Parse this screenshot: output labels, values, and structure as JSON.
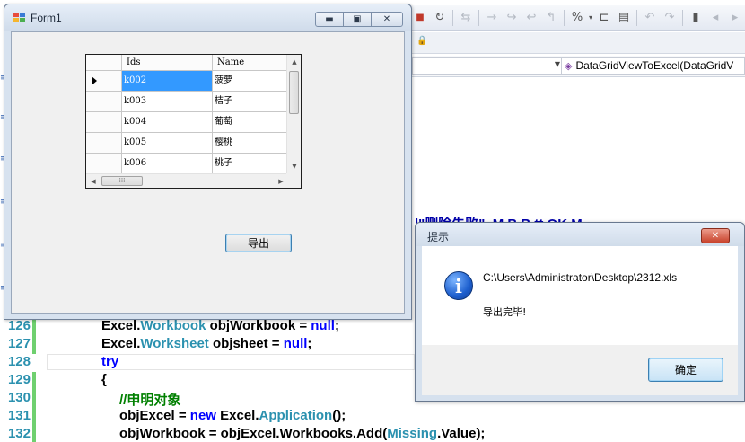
{
  "form1": {
    "title": "Form1",
    "grid": {
      "columns": [
        "Ids",
        "Name"
      ],
      "rows": [
        {
          "ids": "k002",
          "name": "菠萝"
        },
        {
          "ids": "k003",
          "name": "桔子"
        },
        {
          "ids": "k004",
          "name": "葡萄"
        },
        {
          "ids": "k005",
          "name": "樱桃"
        },
        {
          "ids": "k006",
          "name": "桃子"
        }
      ],
      "selected_row": 0
    },
    "export_button": "导出"
  },
  "message_box": {
    "title": "提示",
    "path": "C:\\Users\\Administrator\\Desktop\\2312.xls",
    "message": "导出完毕!",
    "ok_button": "确定",
    "icon": "information-icon"
  },
  "ide": {
    "method_selector": "DataGridViewToExcel(DataGridV",
    "partial_text": "l\"删除失败\", M           B  B  tt     OK  M",
    "code_lines": [
      {
        "num": "126",
        "parts": [
          [
            "ty",
            "Excel."
          ],
          [
            "t",
            "Workbook"
          ],
          [
            "p",
            " objWorkbook = "
          ],
          [
            "kw",
            "null"
          ],
          [
            "p",
            ";"
          ]
        ]
      },
      {
        "num": "127",
        "parts": [
          [
            "ty",
            "Excel."
          ],
          [
            "t",
            "Worksheet"
          ],
          [
            "p",
            " objsheet = "
          ],
          [
            "kw",
            "null"
          ],
          [
            "p",
            ";"
          ]
        ]
      },
      {
        "num": "128",
        "parts": [
          [
            "kw",
            "try"
          ]
        ]
      },
      {
        "num": "129",
        "parts": [
          [
            "p",
            "{"
          ]
        ]
      },
      {
        "num": "130",
        "parts": [
          [
            "cm",
            "//申明对象"
          ]
        ]
      },
      {
        "num": "131",
        "parts": [
          [
            "p",
            "objExcel = "
          ],
          [
            "kw",
            "new"
          ],
          [
            "p",
            " Excel."
          ],
          [
            "t",
            "Application"
          ],
          [
            "p",
            "();"
          ]
        ]
      },
      {
        "num": "132",
        "parts": [
          [
            "p",
            "objWorkbook = objExcel.Workbooks.Add("
          ],
          [
            "t",
            "Missing"
          ],
          [
            "p",
            ".Value);"
          ]
        ]
      }
    ]
  }
}
